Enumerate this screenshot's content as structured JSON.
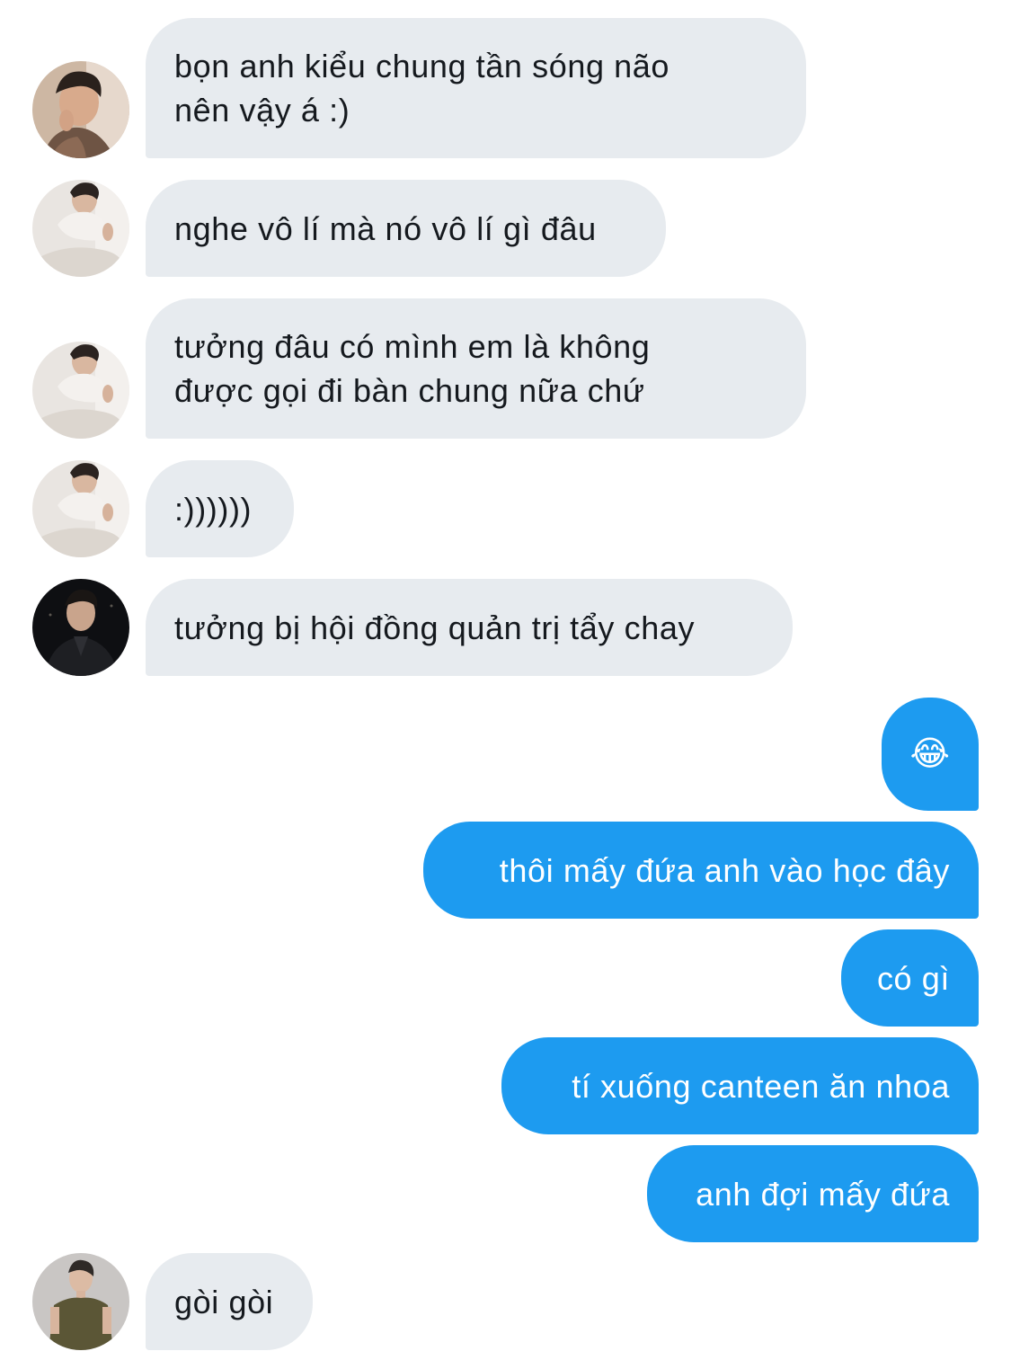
{
  "colors": {
    "received_bubble": "#e7ebef",
    "received_text": "#15191e",
    "sent_bubble": "#1d9bf0",
    "sent_text": "#ffffff"
  },
  "messages": [
    {
      "direction": "received",
      "text": "bọn anh kiểu chung tần sóng não\nnên vậy á :)"
    },
    {
      "direction": "received",
      "text": "nghe vô lí mà nó vô lí gì đâu"
    },
    {
      "direction": "received",
      "text": "tưởng đâu có mình em là không\nđược gọi đi bàn chung nữa chứ"
    },
    {
      "direction": "received",
      "text": ":))))))"
    },
    {
      "direction": "received",
      "text": "tưởng bị hội đồng quản trị tẩy chay"
    },
    {
      "direction": "sent",
      "text": "😂",
      "icon": "tears-of-joy-emoji"
    },
    {
      "direction": "sent",
      "text": "thôi mấy đứa anh vào học đây"
    },
    {
      "direction": "sent",
      "text": "có gì"
    },
    {
      "direction": "sent",
      "text": "tí xuống canteen ăn nhoa"
    },
    {
      "direction": "sent",
      "text": "anh đợi mấy đứa"
    },
    {
      "direction": "received",
      "text": "gòi gòi"
    }
  ]
}
